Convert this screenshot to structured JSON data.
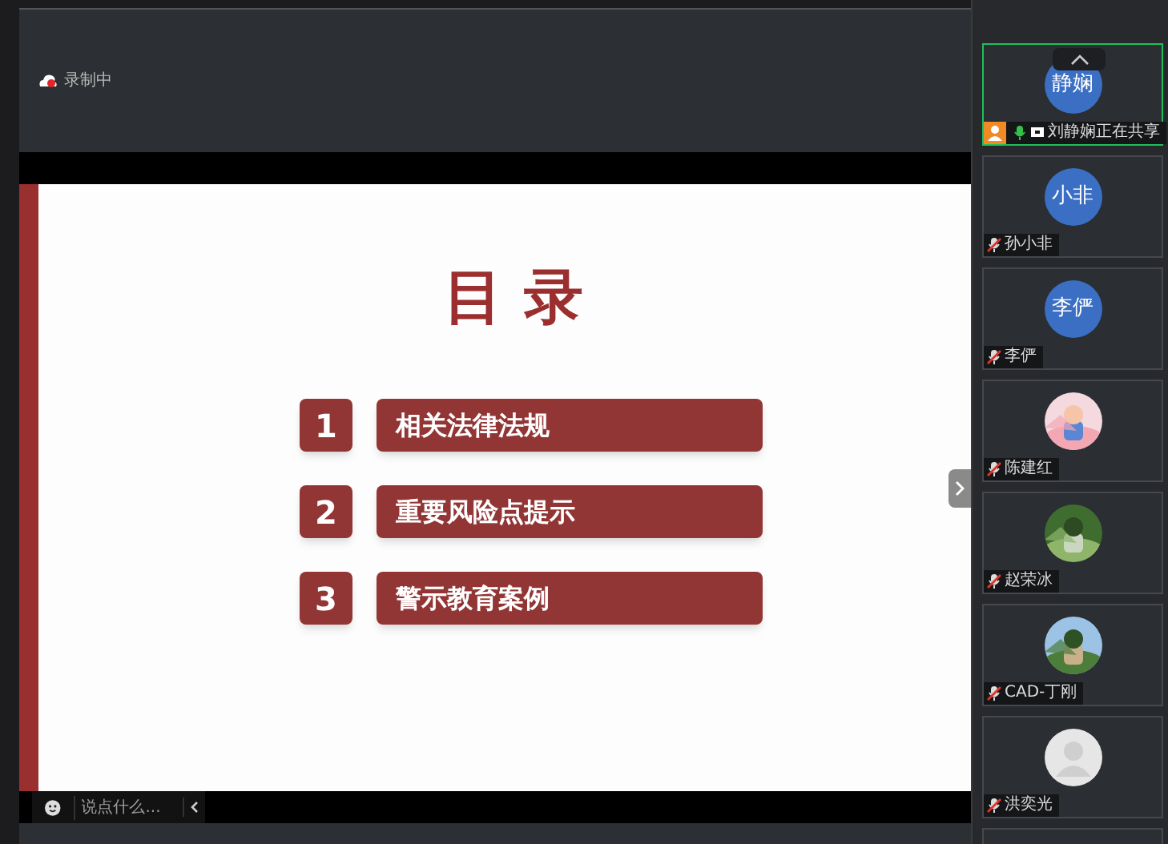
{
  "recording": {
    "label": "录制中"
  },
  "slide": {
    "title": "目 录",
    "items": [
      {
        "number": "1",
        "text": "相关法律法规"
      },
      {
        "number": "2",
        "text": "重要风险点提示"
      },
      {
        "number": "3",
        "text": "警示教育案例"
      }
    ]
  },
  "chat": {
    "placeholder": "说点什么..."
  },
  "participants": [
    {
      "kind": "initials",
      "initials": "静娴",
      "name": "刘静娴正在共享",
      "sharing": true,
      "muted": false,
      "selected": true
    },
    {
      "kind": "initials",
      "initials": "小非",
      "name": "孙小非",
      "sharing": false,
      "muted": true,
      "selected": false
    },
    {
      "kind": "initials",
      "initials": "李俨",
      "name": "李俨",
      "sharing": false,
      "muted": true,
      "selected": false
    },
    {
      "kind": "picture",
      "name": "陈建红",
      "sharing": false,
      "muted": true,
      "selected": false
    },
    {
      "kind": "picture",
      "name": "赵荣冰",
      "sharing": false,
      "muted": true,
      "selected": false
    },
    {
      "kind": "picture",
      "name": "CAD-丁刚",
      "sharing": false,
      "muted": true,
      "selected": false
    },
    {
      "kind": "default",
      "name": "洪奕光",
      "sharing": false,
      "muted": true,
      "selected": false
    }
  ]
}
